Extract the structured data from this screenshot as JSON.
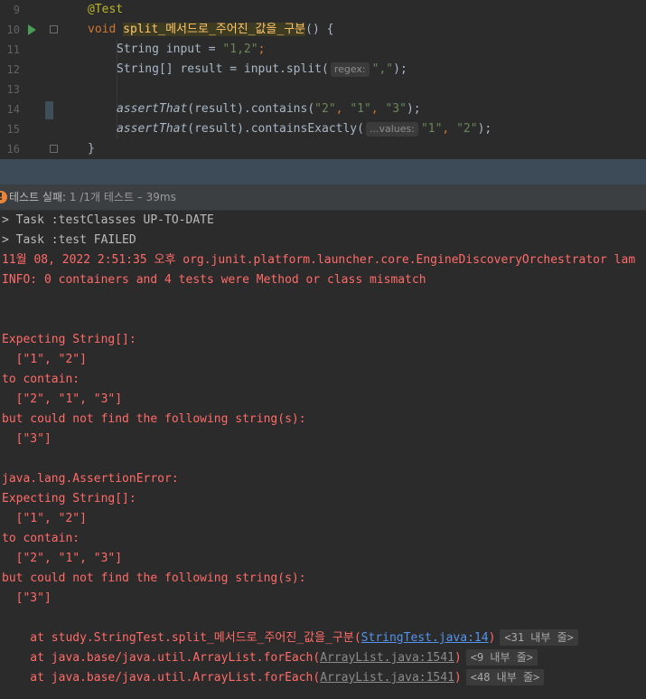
{
  "editor": {
    "lines": [
      {
        "num": "9",
        "annotation": "@Test"
      },
      {
        "num": "10",
        "kw": "void",
        "method": "split_메서드로_주어진_값을_구분",
        "rest": "() {"
      },
      {
        "num": "11",
        "type": "String",
        "mid": " input = ",
        "str": "\"1,2\"",
        "end": ";"
      },
      {
        "num": "12",
        "type": "String[]",
        "mid": " result = input.split(",
        "hint": "regex:",
        "str": "\",\"",
        "end": ");"
      },
      {
        "num": "13"
      },
      {
        "num": "14",
        "fn": "assertThat",
        "mid": "(result).contains(",
        "s1": "\"2\"",
        "c1": ", ",
        "s2": "\"1\"",
        "c2": ", ",
        "s3": "\"3\"",
        "end": ");"
      },
      {
        "num": "15",
        "fn": "assertThat",
        "mid": "(result).containsExactly(",
        "hint": "...values:",
        "s1": "\"1\"",
        "c1": ", ",
        "s2": "\"2\"",
        "end": ");"
      },
      {
        "num": "16",
        "brace": "}"
      }
    ]
  },
  "status": {
    "label": "테스트 실패:",
    "count": " 1 /1개 테스트 – 39ms"
  },
  "console": {
    "lines": [
      "> Task :testClasses UP-TO-DATE",
      "> Task :test FAILED",
      "11월 08, 2022 2:51:35 오후 org.junit.platform.launcher.core.EngineDiscoveryOrchestrator lam",
      "INFO: 0 containers and 4 tests were Method or class mismatch",
      "",
      "",
      "Expecting String[]:",
      "  [\"1\", \"2\"]",
      "to contain:",
      "  [\"2\", \"1\", \"3\"]",
      "but could not find the following string(s):",
      "  [\"3\"]",
      "",
      "java.lang.AssertionError:",
      "Expecting String[]:",
      "  [\"1\", \"2\"]",
      "to contain:",
      "  [\"2\", \"1\", \"3\"]",
      "but could not find the following string(s):",
      "  [\"3\"]",
      ""
    ],
    "stack": [
      {
        "prefix": "    at study.StringTest.split_메서드로_주어진_값을_구분(",
        "link": "StringTest.java:14",
        "suffix": ")",
        "fold": "<31 내부 줄>"
      },
      {
        "prefix": "    at java.base/java.util.ArrayList.forEach(",
        "link": "ArrayList.java:1541",
        "suffix": ")",
        "fold": "<9 내부 줄>"
      },
      {
        "prefix": "    at java.base/java.util.ArrayList.forEach(",
        "link": "ArrayList.java:1541",
        "suffix": ")",
        "fold": "<48 내부 줄>"
      }
    ]
  }
}
